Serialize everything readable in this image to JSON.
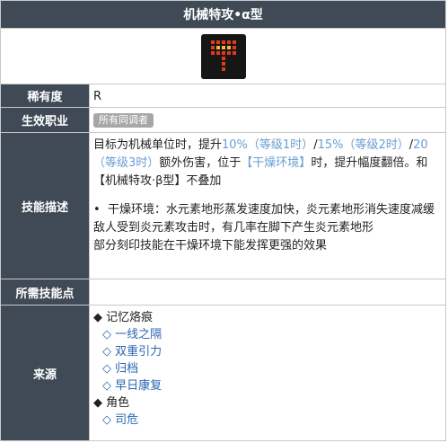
{
  "title": "机械特攻•α型",
  "rarity": {
    "label": "稀有度",
    "value": "R"
  },
  "job": {
    "label": "生效职业",
    "tag": "所有同调者"
  },
  "skill": {
    "label": "技能描述",
    "p1_a": "目标为机械单位时，提升",
    "p1_v1": "10%（等级1时）",
    "p1_s1": "/",
    "p1_v2": "15%（等级2时）",
    "p1_s2": "/",
    "p1_v3": "20（等级3时）",
    "p1_b": "额外伤害，位于",
    "p1_env": "【干燥环境】",
    "p1_c": "时，提升幅度翻倍。和【机械特攻·β型】不叠加",
    "bullet": "•",
    "p2": "干燥环境：水元素地形蒸发速度加快，炎元素地形消失速度减缓",
    "p3": "敌人受到炎元素攻击时，有几率在脚下产生炎元素地形",
    "p4": "部分刻印技能在干燥环境下能发挥更强的效果"
  },
  "points": {
    "label": "所需技能点",
    "value": ""
  },
  "source": {
    "label": "来源",
    "group1": "◆ 记忆烙痕",
    "items1": [
      "◇ 一线之隔",
      "◇ 双重引力",
      "◇ 归档",
      "◇ 早日康复"
    ],
    "group2": "◆ 角色",
    "items2": [
      "◇ 司危"
    ]
  },
  "colors": {
    "header": "#3f4a56",
    "link": "#2b66b3",
    "highlight": "#6a9ed3",
    "icon_glow": "#e23a1a"
  },
  "icon": "axe-icon"
}
